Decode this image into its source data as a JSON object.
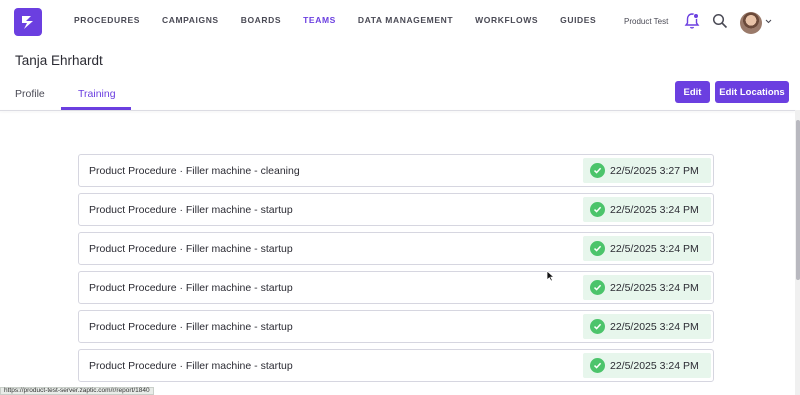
{
  "nav": {
    "items": [
      {
        "label": "PROCEDURES"
      },
      {
        "label": "CAMPAIGNS"
      },
      {
        "label": "BOARDS"
      },
      {
        "label": "TEAMS"
      },
      {
        "label": "DATA MANAGEMENT"
      },
      {
        "label": "WORKFLOWS"
      },
      {
        "label": "GUIDES"
      }
    ],
    "active": "TEAMS",
    "org_name": "Product Test"
  },
  "page": {
    "title": "Tanja Ehrhardt",
    "tabs": [
      {
        "label": "Profile"
      },
      {
        "label": "Training"
      }
    ],
    "active_tab": "Training",
    "buttons": {
      "edit": "Edit",
      "edit_locations": "Edit Locations"
    }
  },
  "trainings": [
    {
      "procedure": "Product Procedure · Filler machine - cleaning",
      "completed": "22/5/2025 3:27 PM"
    },
    {
      "procedure": "Product Procedure · Filler machine - startup",
      "completed": "22/5/2025 3:24 PM"
    },
    {
      "procedure": "Product Procedure · Filler machine - startup",
      "completed": "22/5/2025 3:24 PM"
    },
    {
      "procedure": "Product Procedure · Filler machine - startup",
      "completed": "22/5/2025 3:24 PM"
    },
    {
      "procedure": "Product Procedure · Filler machine - startup",
      "completed": "22/5/2025 3:24 PM"
    },
    {
      "procedure": "Product Procedure · Filler machine - startup",
      "completed": "22/5/2025 3:24 PM"
    }
  ],
  "status_bar": {
    "url": "https://product-test-server.zaptic.com/r/report/1840"
  },
  "colors": {
    "accent": "#6b3fe0",
    "success": "#4cc46b",
    "success_bg": "#e7f6ec"
  },
  "icons": {
    "logo": "zaptic-logo-icon",
    "bell": "bell-icon",
    "search": "search-icon",
    "check": "check-circle-icon",
    "caret": "chevron-down-icon"
  }
}
